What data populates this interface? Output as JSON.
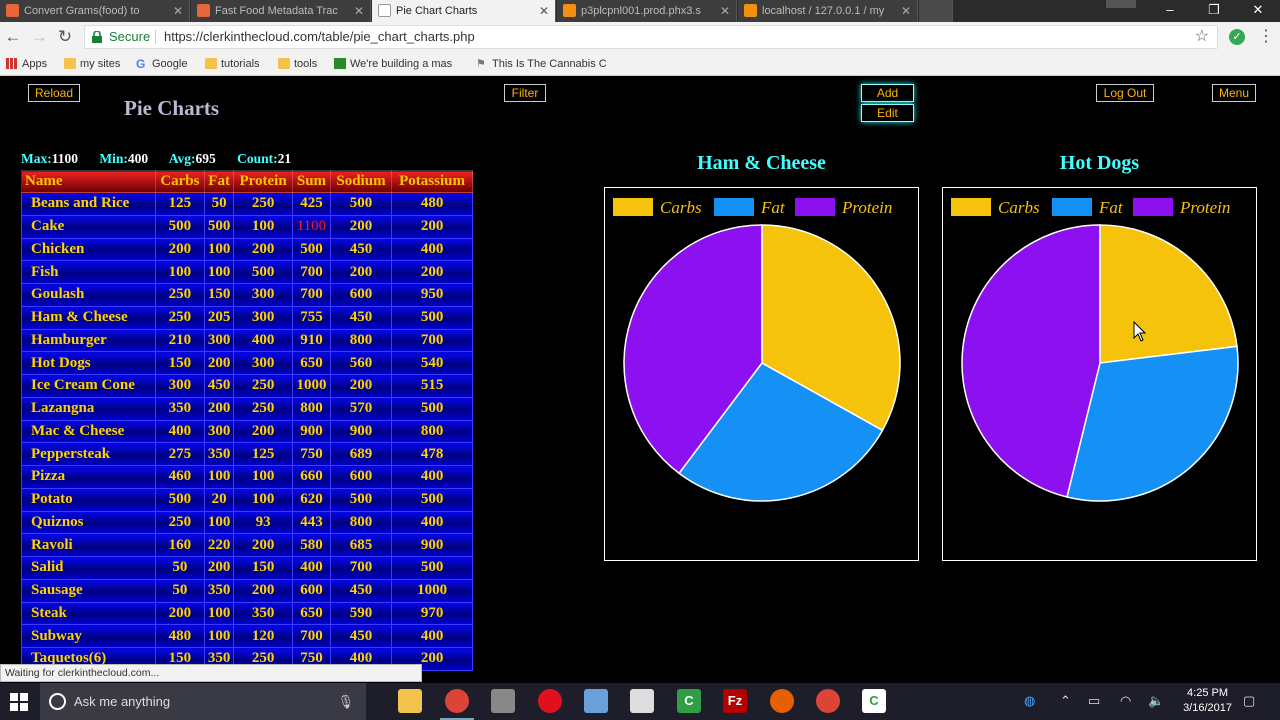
{
  "browser": {
    "tabs": [
      {
        "title": "Convert Grams(food) to",
        "color": "#e8673a"
      },
      {
        "title": "Fast Food Metadata Trac",
        "color": "#e8673a"
      },
      {
        "title": "Pie Chart Charts",
        "color": "#9aa0a6",
        "active": true
      },
      {
        "title": "p3plcpnl001.prod.phx3.s",
        "color": "#f29111"
      },
      {
        "title": "localhost / 127.0.0.1 / my",
        "color": "#f29111"
      }
    ],
    "secure_label": "Secure",
    "url": "https://clerkinthecloud.com/table/pie_chart_charts.php",
    "bookmarks": [
      "Apps",
      "my sites",
      "Google",
      "tutorials",
      "tools",
      "We're building a mas",
      "This Is The Cannabis C"
    ],
    "status_text": "Waiting for clerkinthecloud.com..."
  },
  "toolbar": {
    "reload_label": "Reload",
    "filter_label": "Filter",
    "add_label": "Add",
    "edit_label": "Edit",
    "logout_label": "Log Out",
    "menu_label": "Menu"
  },
  "page": {
    "title": "Pie Charts"
  },
  "stats": {
    "max_label": "Max:",
    "max": "1100",
    "min_label": "Min:",
    "min": "400",
    "avg_label": "Avg:",
    "avg": "695",
    "count_label": "Count:",
    "count": "21"
  },
  "table": {
    "columns": [
      "Name",
      "Carbs",
      "Fat",
      "Protein",
      "Sum",
      "Sodium",
      "Potassium"
    ],
    "rows": [
      [
        "Beans and Rice",
        "125",
        "50",
        "250",
        "425",
        "500",
        "480"
      ],
      [
        "Cake",
        "500",
        "500",
        "100",
        "1100",
        "200",
        "200"
      ],
      [
        "Chicken",
        "200",
        "100",
        "200",
        "500",
        "450",
        "400"
      ],
      [
        "Fish",
        "100",
        "100",
        "500",
        "700",
        "200",
        "200"
      ],
      [
        "Goulash",
        "250",
        "150",
        "300",
        "700",
        "600",
        "950"
      ],
      [
        "Ham & Cheese",
        "250",
        "205",
        "300",
        "755",
        "450",
        "500"
      ],
      [
        "Hamburger",
        "210",
        "300",
        "400",
        "910",
        "800",
        "700"
      ],
      [
        "Hot Dogs",
        "150",
        "200",
        "300",
        "650",
        "560",
        "540"
      ],
      [
        "Ice Cream Cone",
        "300",
        "450",
        "250",
        "1000",
        "200",
        "515"
      ],
      [
        "Lazangna",
        "350",
        "200",
        "250",
        "800",
        "570",
        "500"
      ],
      [
        "Mac & Cheese",
        "400",
        "300",
        "200",
        "900",
        "900",
        "800"
      ],
      [
        "Peppersteak",
        "275",
        "350",
        "125",
        "750",
        "689",
        "478"
      ],
      [
        "Pizza",
        "460",
        "100",
        "100",
        "660",
        "600",
        "400"
      ],
      [
        "Potato",
        "500",
        "20",
        "100",
        "620",
        "500",
        "500"
      ],
      [
        "Quiznos",
        "250",
        "100",
        "93",
        "443",
        "800",
        "400"
      ],
      [
        "Ravoli",
        "160",
        "220",
        "200",
        "580",
        "685",
        "900"
      ],
      [
        "Salid",
        "50",
        "200",
        "150",
        "400",
        "700",
        "500"
      ],
      [
        "Sausage",
        "50",
        "350",
        "200",
        "600",
        "450",
        "1000"
      ],
      [
        "Steak",
        "200",
        "100",
        "350",
        "650",
        "590",
        "970"
      ],
      [
        "Subway",
        "480",
        "100",
        "120",
        "700",
        "450",
        "400"
      ],
      [
        "Taquetos(6)",
        "150",
        "350",
        "250",
        "750",
        "400",
        "200"
      ]
    ],
    "highlight": {
      "row": 1,
      "col": 4,
      "color": "#ff1a1a"
    }
  },
  "chart_data": [
    {
      "type": "pie",
      "title": "Ham & Cheese",
      "categories": [
        "Carbs",
        "Fat",
        "Protein"
      ],
      "values": [
        250,
        205,
        300
      ],
      "colors": [
        "#f5c30c",
        "#1590f5",
        "#8c10f0"
      ],
      "legend": "top"
    },
    {
      "type": "pie",
      "title": "Hot Dogs",
      "categories": [
        "Carbs",
        "Fat",
        "Protein"
      ],
      "values": [
        150,
        200,
        300
      ],
      "colors": [
        "#f5c30c",
        "#1590f5",
        "#8c10f0"
      ],
      "legend": "top"
    }
  ],
  "taskbar": {
    "search_placeholder": "Ask me anything",
    "time": "4:25 PM",
    "date": "3/16/2017"
  }
}
